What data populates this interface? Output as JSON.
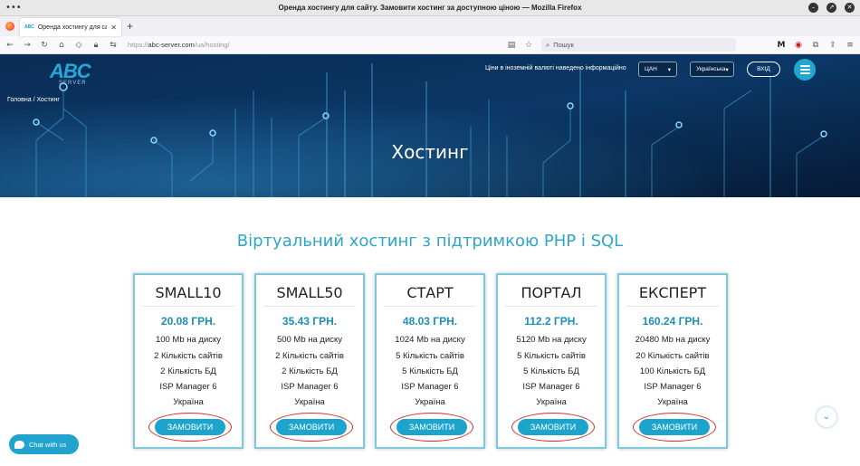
{
  "window": {
    "title": "Оренда хостингу для сайту. Замовити хостинг за доступною ціною — Mozilla Firefox"
  },
  "tab": {
    "label": "Оренда хостингу для сайту",
    "favicon": "ABC"
  },
  "address": {
    "prefix": "https://",
    "host": "abc-server.com",
    "path": "/ua/hosting/"
  },
  "search": {
    "placeholder": "Пошук"
  },
  "header": {
    "logo_main": "ABC",
    "logo_sub": "SERVER",
    "currency_note": "Ціни в іноземній валюті наведено інформаційно",
    "currency": "ЦАН",
    "language": "Українська",
    "login": "ВХІД"
  },
  "breadcrumb": {
    "home": "Головна",
    "sep": "/",
    "current": "Хостинг"
  },
  "hero": {
    "title": "Хостинг"
  },
  "section": {
    "title": "Віртуальний хостинг з підтримкою PHP і SQL"
  },
  "plans": [
    {
      "name": "SMALL10",
      "price": "20.08 ГРН.",
      "disk": "100 Mb на диску",
      "sites": "2 Кількість сайтів",
      "db": "2 Кількість БД",
      "panel": "ISP Manager 6",
      "country": "Україна",
      "order": "ЗАМОВИТИ"
    },
    {
      "name": "SMALL50",
      "price": "35.43 ГРН.",
      "disk": "500 Mb на диску",
      "sites": "2 Кількість сайтів",
      "db": "2 Кількість БД",
      "panel": "ISP Manager 6",
      "country": "Україна",
      "order": "ЗАМОВИТИ"
    },
    {
      "name": "СТАРТ",
      "price": "48.03 ГРН.",
      "disk": "1024 Mb на диску",
      "sites": "5 Кількість сайтів",
      "db": "5 Кількість БД",
      "panel": "ISP Manager 6",
      "country": "Україна",
      "order": "ЗАМОВИТИ"
    },
    {
      "name": "ПОРТАЛ",
      "price": "112.2 ГРН.",
      "disk": "5120 Mb на диску",
      "sites": "5 Кількість сайтів",
      "db": "5 Кількість БД",
      "panel": "ISP Manager 6",
      "country": "Україна",
      "order": "ЗАМОВИТИ"
    },
    {
      "name": "ЕКСПЕРТ",
      "price": "160.24 ГРН.",
      "disk": "20480 Mb на диску",
      "sites": "20 Кількість сайтів",
      "db": "100 Кількість БД",
      "panel": "ISP Manager 6",
      "country": "Україна",
      "order": "ЗАМОВИТИ"
    }
  ],
  "chat": {
    "label": "Chat with us"
  },
  "colors": {
    "accent": "#1da4cc",
    "hero_bg": "#081e3c",
    "title": "#2fa6c6",
    "highlight": "#d23030"
  }
}
